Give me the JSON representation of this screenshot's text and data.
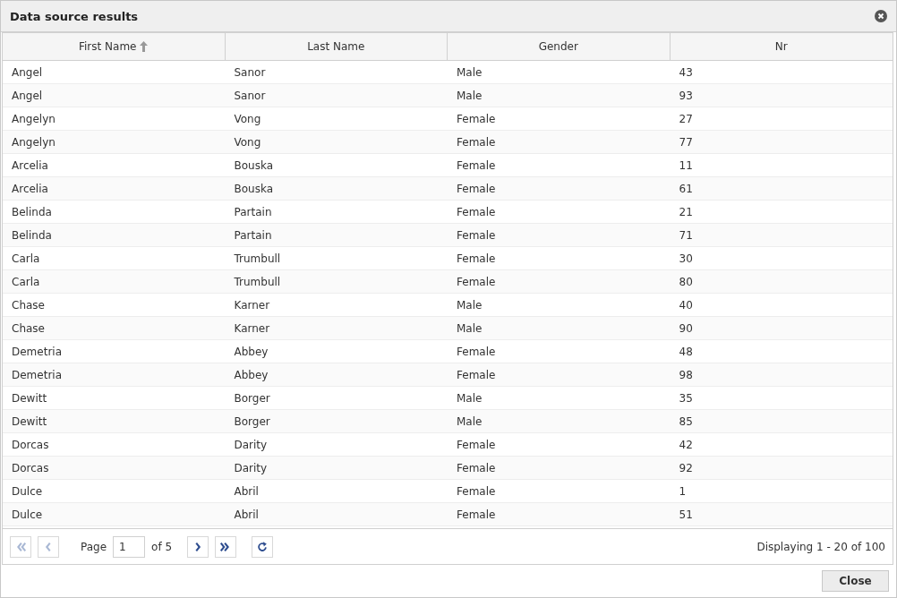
{
  "window": {
    "title": "Data source results"
  },
  "table": {
    "columns": [
      {
        "label": "First Name",
        "sorted": true
      },
      {
        "label": "Last Name",
        "sorted": false
      },
      {
        "label": "Gender",
        "sorted": false
      },
      {
        "label": "Nr",
        "sorted": false
      }
    ],
    "rows": [
      [
        "Angel",
        "Sanor",
        "Male",
        "43"
      ],
      [
        "Angel",
        "Sanor",
        "Male",
        "93"
      ],
      [
        "Angelyn",
        "Vong",
        "Female",
        "27"
      ],
      [
        "Angelyn",
        "Vong",
        "Female",
        "77"
      ],
      [
        "Arcelia",
        "Bouska",
        "Female",
        "11"
      ],
      [
        "Arcelia",
        "Bouska",
        "Female",
        "61"
      ],
      [
        "Belinda",
        "Partain",
        "Female",
        "21"
      ],
      [
        "Belinda",
        "Partain",
        "Female",
        "71"
      ],
      [
        "Carla",
        "Trumbull",
        "Female",
        "30"
      ],
      [
        "Carla",
        "Trumbull",
        "Female",
        "80"
      ],
      [
        "Chase",
        "Karner",
        "Male",
        "40"
      ],
      [
        "Chase",
        "Karner",
        "Male",
        "90"
      ],
      [
        "Demetria",
        "Abbey",
        "Female",
        "48"
      ],
      [
        "Demetria",
        "Abbey",
        "Female",
        "98"
      ],
      [
        "Dewitt",
        "Borger",
        "Male",
        "35"
      ],
      [
        "Dewitt",
        "Borger",
        "Male",
        "85"
      ],
      [
        "Dorcas",
        "Darity",
        "Female",
        "42"
      ],
      [
        "Dorcas",
        "Darity",
        "Female",
        "92"
      ],
      [
        "Dulce",
        "Abril",
        "Female",
        "1"
      ],
      [
        "Dulce",
        "Abril",
        "Female",
        "51"
      ]
    ]
  },
  "pager": {
    "buttons_before": [
      {
        "kind": "first",
        "disabled": true
      },
      {
        "kind": "prev",
        "disabled": true
      }
    ],
    "page_label": "Page",
    "page_value": "1",
    "of_label": "of 5",
    "buttons_after": [
      {
        "kind": "next",
        "disabled": false
      },
      {
        "kind": "last",
        "disabled": false
      },
      {
        "kind": "refresh",
        "disabled": false
      }
    ],
    "display_text": "Displaying 1 - 20 of 100"
  },
  "buttons": [
    "Close"
  ]
}
